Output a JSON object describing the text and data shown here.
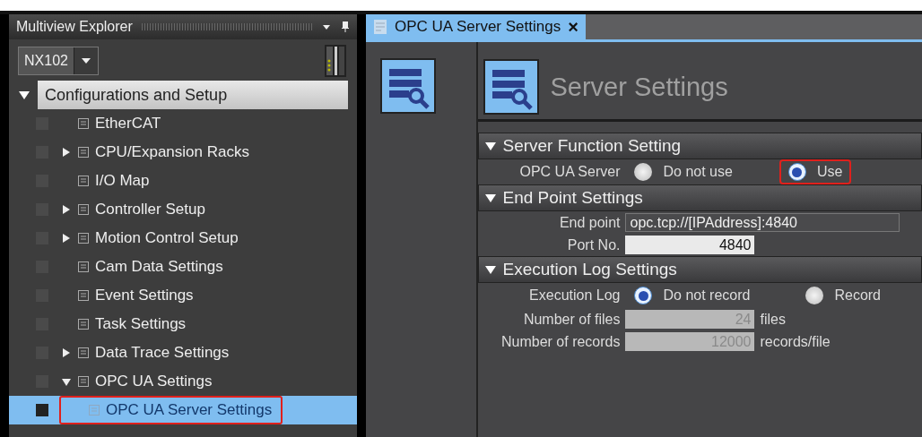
{
  "explorer": {
    "title": "Multiview Explorer",
    "device": "NX102",
    "tree": [
      {
        "label": "Configurations and Setup",
        "selected": false,
        "expanded": true,
        "children": [
          {
            "label": "EtherCAT",
            "selected": false,
            "highlighted": false
          },
          {
            "label": "CPU/Expansion Racks",
            "selected": false,
            "highlighted": false,
            "expanded": false
          },
          {
            "label": "I/O Map",
            "selected": false,
            "highlighted": false
          },
          {
            "label": "Controller Setup",
            "selected": false,
            "highlighted": false,
            "expanded": false
          },
          {
            "label": "Motion Control Setup",
            "selected": false,
            "highlighted": false,
            "expanded": false
          },
          {
            "label": "Cam Data Settings",
            "selected": false,
            "highlighted": false
          },
          {
            "label": "Event Settings",
            "selected": false,
            "highlighted": false
          },
          {
            "label": "Task Settings",
            "selected": false,
            "highlighted": false
          },
          {
            "label": "Data Trace Settings",
            "selected": false,
            "highlighted": false,
            "expanded": false
          },
          {
            "label": "OPC UA Settings",
            "selected": false,
            "highlighted": false,
            "expanded": true,
            "children": [
              {
                "label": "OPC UA Server Settings",
                "selected": true,
                "highlighted": true
              }
            ]
          }
        ]
      }
    ]
  },
  "editor": {
    "tabs": [
      {
        "label": "OPC UA Server Settings",
        "close": "×",
        "selected": true
      }
    ],
    "heading": "Server Settings",
    "sections": [
      {
        "title": "Server Function Setting",
        "expanded": true,
        "rows": [
          {
            "kind": "radio",
            "label": "OPC UA Server",
            "options": [
              {
                "label": "Do not use",
                "selected": false,
                "highlighted": false
              },
              {
                "label": "Use",
                "selected": true,
                "highlighted": true
              }
            ]
          }
        ]
      },
      {
        "title": "End Point Settings",
        "expanded": true,
        "rows": [
          {
            "kind": "field",
            "label": "End point",
            "value": "opc.tcp://[IPAddress]:4840",
            "wide": true,
            "disabled": false
          },
          {
            "kind": "field",
            "label": "Port No.",
            "value": "4840",
            "wide": false,
            "disabled": false
          }
        ]
      },
      {
        "title": "Execution Log Settings",
        "expanded": true,
        "rows": [
          {
            "kind": "radio",
            "label": "Execution Log",
            "options": [
              {
                "label": "Do not record",
                "selected": true,
                "highlighted": false
              },
              {
                "label": "Record",
                "selected": false,
                "highlighted": false
              }
            ]
          },
          {
            "kind": "field",
            "label": "Number of files",
            "value": "24",
            "unit": "files",
            "wide": false,
            "disabled": true
          },
          {
            "kind": "field",
            "label": "Number of records",
            "value": "12000",
            "unit": "records/file",
            "wide": false,
            "disabled": true
          }
        ]
      }
    ]
  }
}
